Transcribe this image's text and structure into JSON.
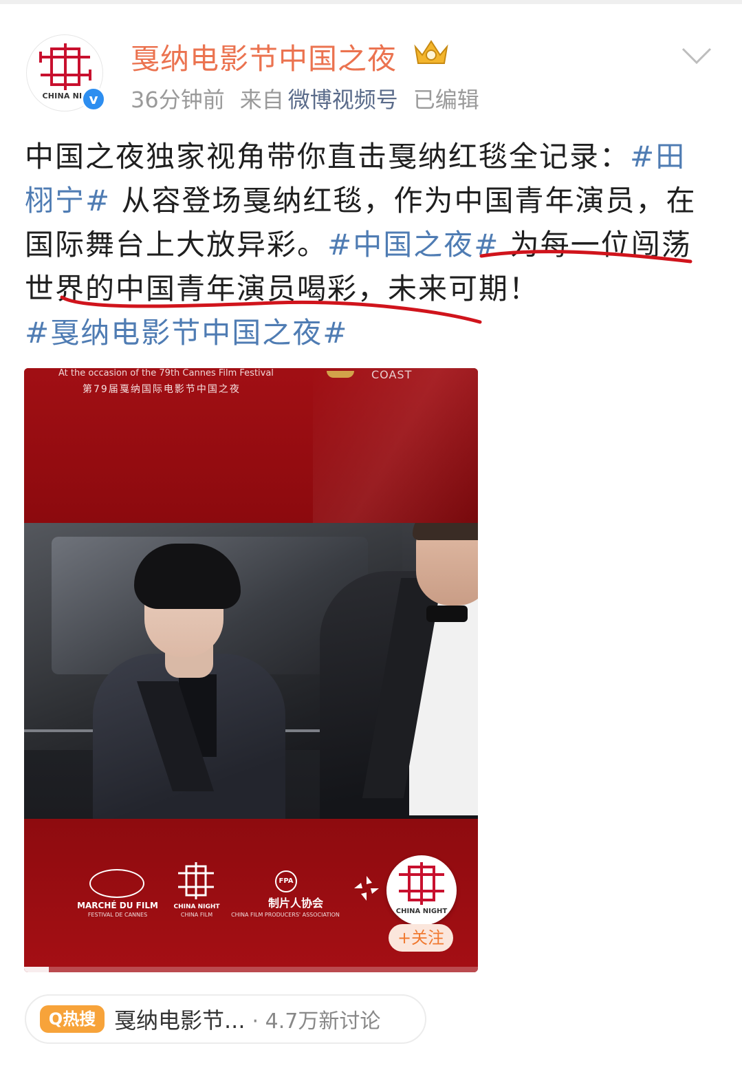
{
  "account": {
    "name": "戛纳电影节中国之夜",
    "avatar_text": "CHINA NIG",
    "verified_badge": "v",
    "time": "36分钟前",
    "source_prefix": "来自",
    "source": "微博视频号",
    "edited": "已编辑"
  },
  "post": {
    "line1": "中国之夜独家视角带你直击戛纳红毯全记录：",
    "tag1": "#田栩宁#",
    "text2": " 从容登场戛纳红毯，作为中国青年演员，在国际舞台上大放异彩。",
    "tag2": "#中国之夜#",
    "text3": " 为每一位闯荡世界的中国青年演员喝彩，未来可期！",
    "tag3": "#戛纳电影节中国之夜#"
  },
  "video": {
    "occasion_en": "At the occasion of the 79th Cannes Film Festival",
    "occasion_cn": "第79届戛纳国际电影节中国之夜",
    "coast": "COAST",
    "logos": {
      "marche": "MARCHÉ DU FILM",
      "marche_sub": "FESTIVAL DE CANNES",
      "chinanight": "CHINA NIGHT",
      "chinanight_sub": "CHINA FILM",
      "fpa_badge": "FPA",
      "fpa_cn": "制片人协会",
      "fpa_en": "CHINA FILM PRODUCERS' ASSOCIATION"
    },
    "float_avatar_text": "CHINA NIGHT",
    "follow_label": "+关注",
    "progress": 0.055
  },
  "hot_search": {
    "badge": "Q热搜",
    "title": "戛纳电影节...",
    "count": "· 4.7万新讨论"
  },
  "colors": {
    "username": "#eb7350",
    "hashtag": "#4f7cb3",
    "underline": "#d0141c",
    "hot_badge": "#f7a33a",
    "video_red": "#9b0c10"
  }
}
